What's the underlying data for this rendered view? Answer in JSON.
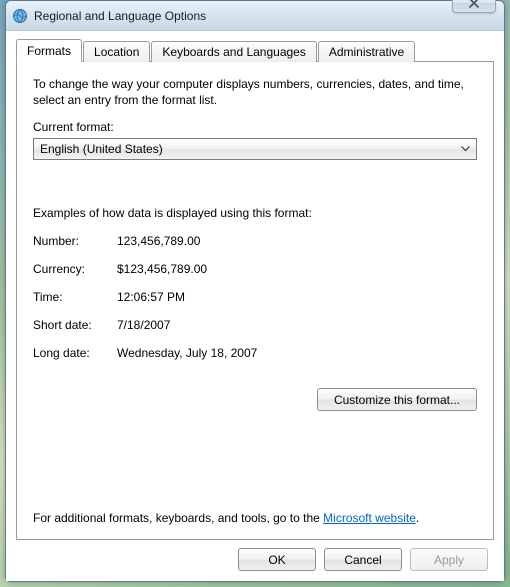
{
  "window": {
    "title": "Regional and Language Options"
  },
  "tabs": {
    "t0": "Formats",
    "t1": "Location",
    "t2": "Keyboards and Languages",
    "t3": "Administrative"
  },
  "formats": {
    "description": "To change the way your computer displays numbers, currencies, dates, and time, select an entry from the format list.",
    "current_format_label": "Current format:",
    "current_format_value": "English (United States)",
    "examples_heading": "Examples of how data is displayed using this format:",
    "rows": {
      "number_label": "Number:",
      "number_value": "123,456,789.00",
      "currency_label": "Currency:",
      "currency_value": "$123,456,789.00",
      "time_label": "Time:",
      "time_value": "12:06:57 PM",
      "shortdate_label": "Short date:",
      "shortdate_value": "7/18/2007",
      "longdate_label": "Long date:",
      "longdate_value": "Wednesday, July 18, 2007"
    },
    "customize_label": "Customize this format...",
    "footer_prefix": "For additional formats, keyboards, and tools, go to the ",
    "footer_link": "Microsoft website",
    "footer_suffix": "."
  },
  "buttons": {
    "ok": "OK",
    "cancel": "Cancel",
    "apply": "Apply"
  }
}
